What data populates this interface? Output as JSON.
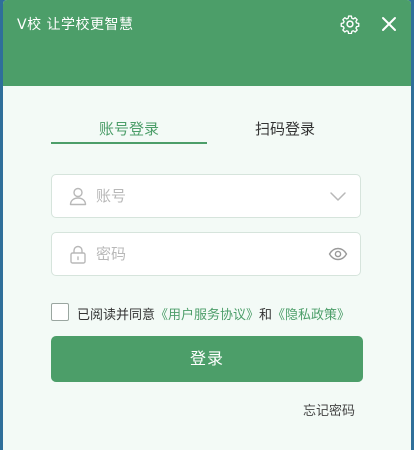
{
  "window": {
    "title": "V校 让学校更智慧"
  },
  "titlebar": {
    "settings_icon": "gear-icon",
    "close_icon": "close-icon"
  },
  "tabs": [
    {
      "label": "账号登录",
      "active": true
    },
    {
      "label": "扫码登录",
      "active": false
    }
  ],
  "form": {
    "account": {
      "placeholder": "账号",
      "value": "",
      "lead_icon": "user-icon",
      "trail_icon": "chevron-down-icon"
    },
    "password": {
      "placeholder": "密码",
      "value": "",
      "lead_icon": "lock-icon",
      "trail_icon": "eye-icon"
    }
  },
  "agreement": {
    "checked": false,
    "prefix": "已阅读并同意",
    "terms_link": "《用户服务协议》",
    "connector": "和",
    "privacy_link": "《隐私政策》"
  },
  "actions": {
    "login_label": "登录",
    "forgot_label": "忘记密码"
  },
  "colors": {
    "accent": "#4c9e69",
    "background": "#f3faf6",
    "desktop": "#2f6f9a"
  }
}
